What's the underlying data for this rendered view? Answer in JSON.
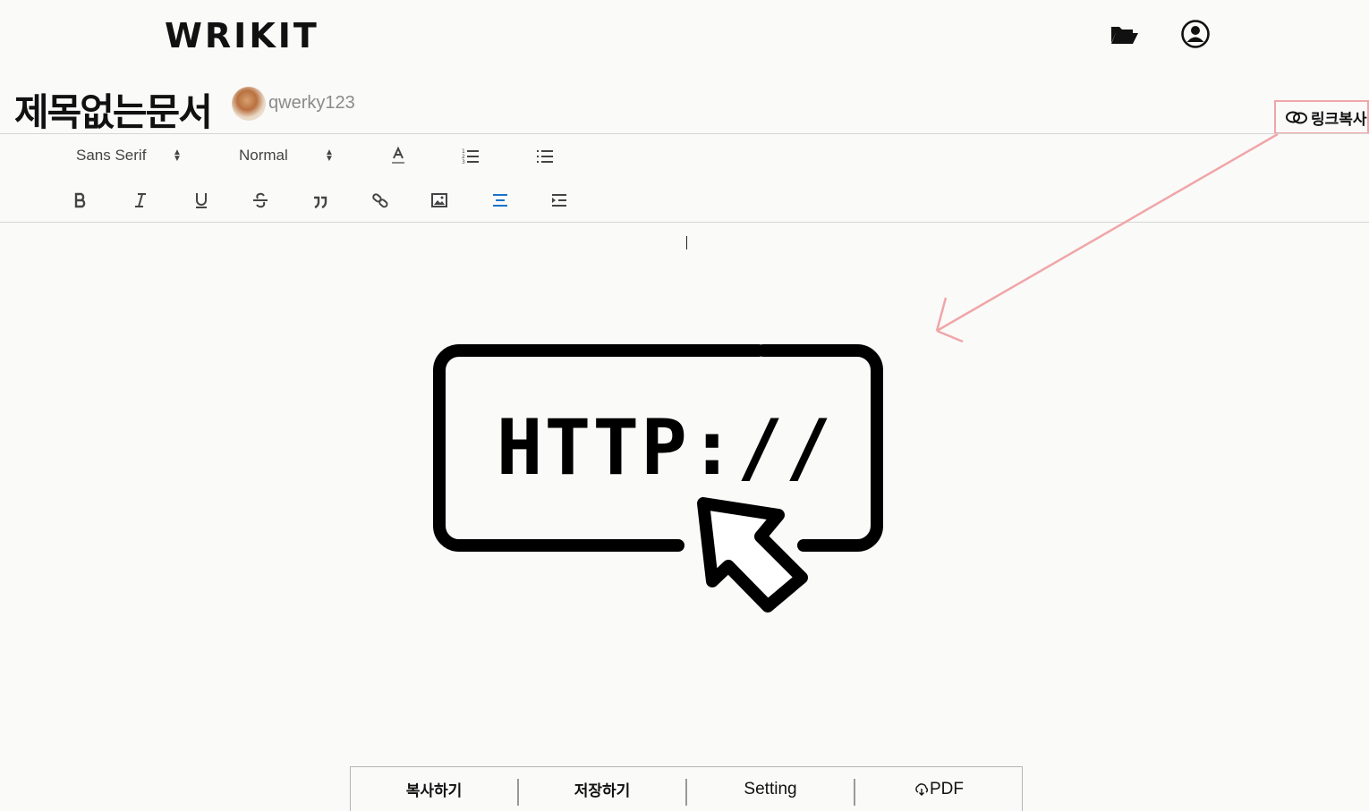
{
  "header": {
    "logo": "WRIKIT",
    "icons": [
      "folder-open-icon",
      "user-circle-icon"
    ]
  },
  "document": {
    "title": "제목없는문서",
    "username": "qwerky123",
    "copy_link_label": "링크복사"
  },
  "toolbar": {
    "font_select": "Sans Serif",
    "size_select": "Normal",
    "row1_buttons": [
      "text-color-icon",
      "ordered-list-icon",
      "bullet-list-icon"
    ],
    "row2_buttons": [
      "bold-icon",
      "italic-icon",
      "underline-icon",
      "strikethrough-icon",
      "blockquote-icon",
      "link-icon",
      "image-icon",
      "align-center-icon",
      "indent-icon"
    ]
  },
  "content": {
    "image_text": "HTTP://"
  },
  "bottom_bar": {
    "copy": "복사하기",
    "save": "저장하기",
    "setting": "Setting",
    "pdf": "PDF"
  },
  "colors": {
    "background": "#fafaf9",
    "accent_blue": "#1a73c9",
    "annotation_pink": "#f0a6a8"
  }
}
